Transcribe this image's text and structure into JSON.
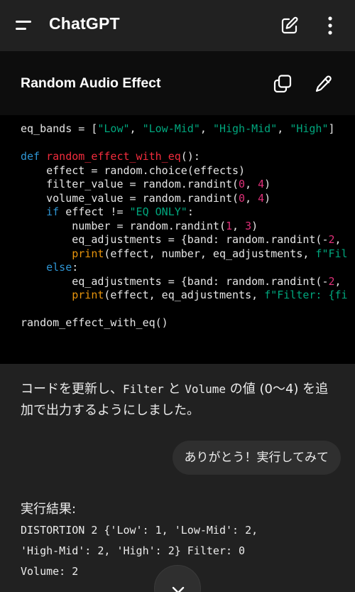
{
  "app": {
    "title": "ChatGPT"
  },
  "header": {
    "menu_icon": "menu-icon",
    "new_chat_icon": "edit-icon",
    "more_icon": "more-vertical-icon"
  },
  "code_block": {
    "title": "Random Audio Effect",
    "copy_icon": "copy-icon",
    "edit_icon": "pencil-icon",
    "lines": [
      "eq_bands = [\"Low\", \"Low-Mid\", \"High-Mid\", \"High\"]",
      "",
      "def random_effect_with_eq():",
      "    effect = random.choice(effects)",
      "    filter_value = random.randint(0, 4)",
      "    volume_value = random.randint(0, 4)",
      "    if effect != \"EQ ONLY\":",
      "        number = random.randint(1, 3)",
      "        eq_adjustments = {band: random.randint(-2,",
      "        print(effect, number, eq_adjustments, f\"Fil",
      "    else:",
      "        eq_adjustments = {band: random.randint(-2,",
      "        print(effect, eq_adjustments, f\"Filter: {fi",
      "",
      "random_effect_with_eq()"
    ]
  },
  "messages": {
    "assistant_1": {
      "part1": "コードを更新し、",
      "code1": "Filter",
      "part2": " と ",
      "code2": "Volume",
      "part3": " の値 (0〜4) を追加で出力するようにしました。"
    },
    "user_1": "ありがとう！実行してみて",
    "assistant_2": {
      "label": "実行結果:",
      "output": "DISTORTION 2 {'Low': 1, 'Low-Mid': 2,\n'High-Mid': 2, 'High': 2} Filter: 0\nVolume: 2"
    }
  },
  "scroll_down": {
    "icon": "chevron-down-icon"
  },
  "colors": {
    "background": "#212121",
    "code_bg": "#000000",
    "bubble": "#2f2f2f",
    "keyword": "#2e95d3",
    "function": "#f22c3d",
    "string": "#00a67d",
    "number": "#df3079"
  }
}
